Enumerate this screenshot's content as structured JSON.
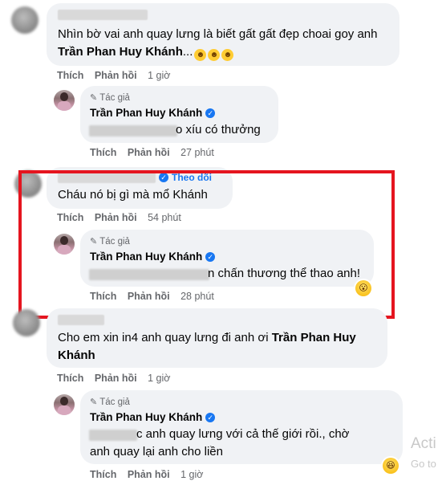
{
  "comments": [
    {
      "text": "Nhìn bờ vai anh quay lưng là biết gất gất đẹp choai goy anh",
      "mention": "Trần Phan Huy Khánh",
      "suffix": "...",
      "like_label": "Thích",
      "reply_label": "Phản hồi",
      "time": "1 giờ",
      "reply": {
        "author_tag": "Tác giả",
        "author": "Trần Phan Huy Khánh",
        "text_visible": "o xíu có thưởng",
        "like_label": "Thích",
        "reply_label": "Phản hồi",
        "time": "27 phút"
      }
    },
    {
      "follow_label": "Theo dõi",
      "text": "Cháu nó bị gì mà mổ Khánh",
      "like_label": "Thích",
      "reply_label": "Phản hồi",
      "time": "54 phút",
      "reply": {
        "author_tag": "Tác giả",
        "author": "Trần Phan Huy Khánh",
        "text_visible": "n chấn thương thể thao anh!",
        "like_label": "Thích",
        "reply_label": "Phản hồi",
        "time": "28 phút",
        "reaction": "wow"
      }
    },
    {
      "text": "Cho em xin in4 anh quay lưng đi anh ơi",
      "mention_line1": "Trần Phan Huy",
      "mention_line2": "Khánh",
      "like_label": "Thích",
      "reply_label": "Phản hồi",
      "time": "1 giờ",
      "reply": {
        "author_tag": "Tác giả",
        "author": "Trần Phan Huy Khánh",
        "text_line1_visible": "c anh quay lưng với cả thế giới rồi., chờ",
        "text_line2": "anh quay lại anh cho liền",
        "like_label": "Thích",
        "reply_label": "Phản hồi",
        "time": "1 giờ",
        "reaction": "haha"
      }
    }
  ],
  "watermark": {
    "line1": "Acti",
    "line2": "Go to"
  },
  "colors": {
    "bubble": "#f0f2f5",
    "action_text": "#65676b",
    "verified": "#1877f2",
    "highlight_border": "#e5151f"
  }
}
